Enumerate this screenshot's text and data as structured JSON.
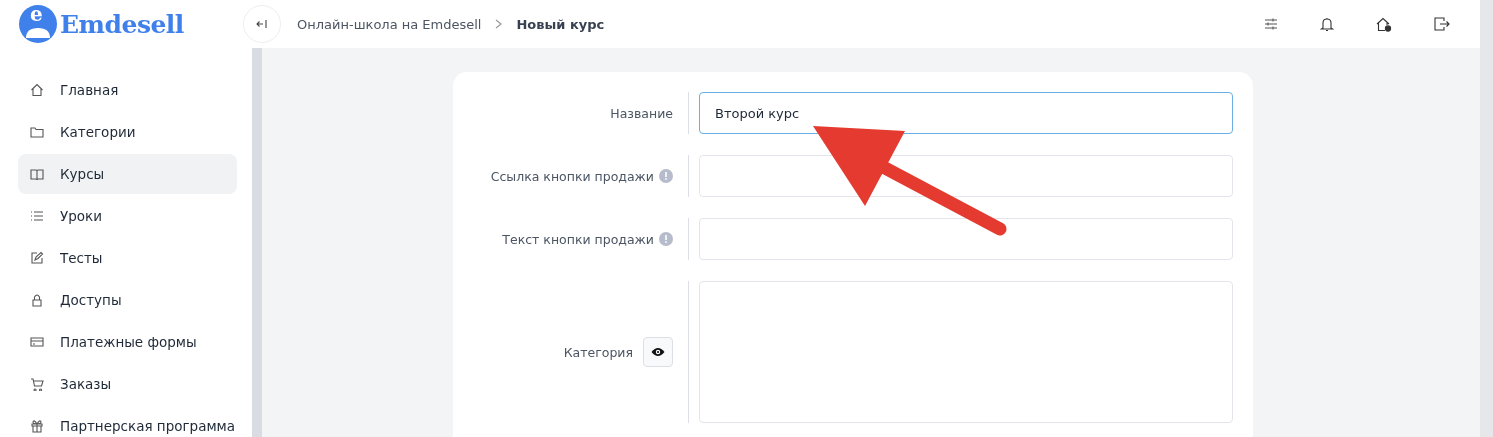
{
  "logo": {
    "letter": "e",
    "name": "Emdesell"
  },
  "sidebar": {
    "items": [
      {
        "label": "Главная",
        "selected": false
      },
      {
        "label": "Категории",
        "selected": false
      },
      {
        "label": "Курсы",
        "selected": true
      },
      {
        "label": "Уроки",
        "selected": false
      },
      {
        "label": "Тесты",
        "selected": false
      },
      {
        "label": "Доступы",
        "selected": false
      },
      {
        "label": "Платежные формы",
        "selected": false
      },
      {
        "label": "Заказы",
        "selected": false
      },
      {
        "label": "Партнерская программа",
        "selected": false
      }
    ]
  },
  "breadcrumbs": [
    {
      "label": "Онлайн-школа на Emdesell",
      "current": false
    },
    {
      "label": "Новый курс",
      "current": true
    }
  ],
  "form": {
    "fields": [
      {
        "kind": "input",
        "label": "Название",
        "value": "Второй курс",
        "info": false,
        "focused": true,
        "preview_button": false
      },
      {
        "kind": "input",
        "label": "Ссылка кнопки продажи",
        "info": true,
        "focused": false,
        "preview_button": false
      },
      {
        "kind": "input",
        "label": "Текст кнопки продажи",
        "info": true,
        "focused": false,
        "preview_button": false
      },
      {
        "kind": "textarea",
        "label": "Категория",
        "info": false,
        "focused": false,
        "preview_button": true
      }
    ]
  }
}
